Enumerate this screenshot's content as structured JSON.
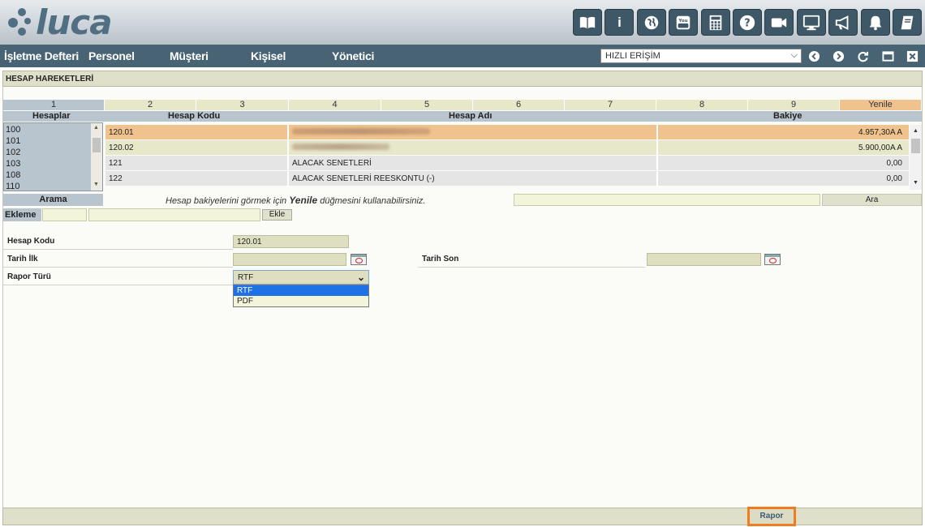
{
  "app": {
    "logo_text": "luca"
  },
  "toolbar": {
    "items": [
      {
        "icon": "book-icon"
      },
      {
        "icon": "info-icon",
        "glyph": "i"
      },
      {
        "icon": "globe-icon"
      },
      {
        "icon": "youtube-icon"
      },
      {
        "icon": "calculator-icon"
      },
      {
        "icon": "help-icon",
        "glyph": "?"
      },
      {
        "icon": "video-camera-icon"
      },
      {
        "icon": "monitor-icon"
      },
      {
        "icon": "megaphone-icon"
      },
      {
        "icon": "bell-icon"
      },
      {
        "icon": "notebook-icon"
      }
    ]
  },
  "nav": {
    "items": [
      "İşletme Defteri",
      "Personel",
      "Müşteri",
      "Kişisel",
      "Yönetici"
    ],
    "quick_access": "HIZLI ERİŞİM"
  },
  "panel": {
    "title": "HESAP HAREKETLERİ"
  },
  "number_row": [
    "1",
    "2",
    "3",
    "4",
    "5",
    "6",
    "7",
    "8",
    "9",
    "Yenile"
  ],
  "columns": {
    "hesaplar": "Hesaplar",
    "kod": "Hesap Kodu",
    "ad": "Hesap Adı",
    "bakiye": "Bakiye"
  },
  "hesap_list": [
    "100",
    "101",
    "102",
    "103",
    "108",
    "110"
  ],
  "accounts": [
    {
      "code": "120.01",
      "name": "",
      "balance": "4.957,30A A",
      "style": "orange"
    },
    {
      "code": "120.02",
      "name": "",
      "balance": "5.900,00A A",
      "style": "olive"
    },
    {
      "code": "121",
      "name": "ALACAK SENETLERİ",
      "balance": "0,00",
      "style": "grey"
    },
    {
      "code": "122",
      "name": "ALACAK SENETLERİ REESKONTU (-)",
      "balance": "0,00",
      "style": "grey"
    }
  ],
  "search": {
    "label": "Arama",
    "hint_prefix": "Hesap bakiyelerini görmek için",
    "hint_bold": "Yenile",
    "hint_suffix": "düğmesini kullanabilirsiniz.",
    "button": "Ara"
  },
  "add": {
    "label": "Ekleme",
    "button": "Ekle"
  },
  "form": {
    "hesap_kodu_label": "Hesap Kodu",
    "hesap_kodu_value": "120.01",
    "tarih_ilk_label": "Tarih İlk",
    "tarih_son_label": "Tarih Son",
    "rapor_turu_label": "Rapor Türü",
    "rapor_turu_value": "RTF",
    "rapor_turu_options": [
      "RTF",
      "PDF"
    ]
  },
  "footer": {
    "rapor_button": "Rapor"
  },
  "colors": {
    "nav_bg": "#486373",
    "accent_orange": "#f07c1f",
    "highlight_row": "#f0c38e",
    "dropdown_selected": "#1e72e6"
  }
}
